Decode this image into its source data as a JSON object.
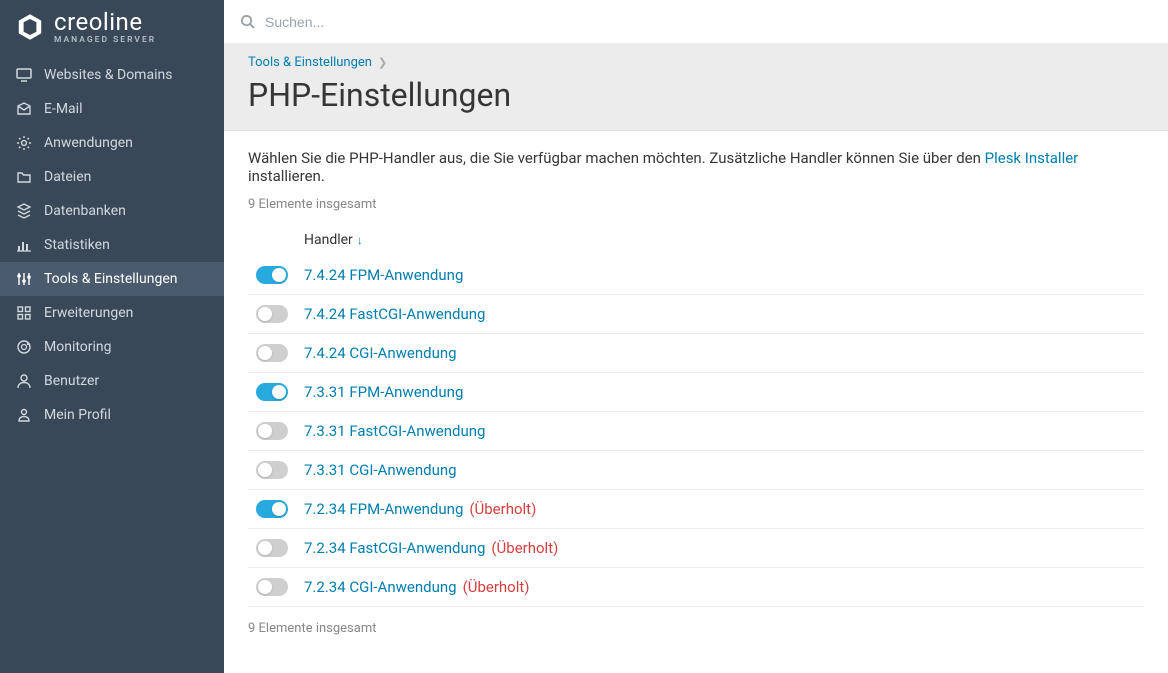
{
  "logo": {
    "main": "creoline",
    "sub": "MANAGED SERVER"
  },
  "search": {
    "placeholder": "Suchen..."
  },
  "sidebar": {
    "items": [
      {
        "label": "Websites & Domains",
        "icon": "monitor",
        "active": false
      },
      {
        "label": "E-Mail",
        "icon": "mail",
        "active": false
      },
      {
        "label": "Anwendungen",
        "icon": "gear",
        "active": false
      },
      {
        "label": "Dateien",
        "icon": "folder",
        "active": false
      },
      {
        "label": "Datenbanken",
        "icon": "layers",
        "active": false
      },
      {
        "label": "Statistiken",
        "icon": "stats",
        "active": false
      },
      {
        "label": "Tools & Einstellungen",
        "icon": "sliders",
        "active": true
      },
      {
        "label": "Erweiterungen",
        "icon": "grid",
        "active": false
      },
      {
        "label": "Monitoring",
        "icon": "radar",
        "active": false
      },
      {
        "label": "Benutzer",
        "icon": "user",
        "active": false
      },
      {
        "label": "Mein Profil",
        "icon": "profile",
        "active": false
      }
    ]
  },
  "breadcrumb": {
    "parent": "Tools & Einstellungen"
  },
  "page_title": "PHP-Einstellungen",
  "intro": {
    "prefix": "Wählen Sie die PHP-Handler aus, die Sie verfügbar machen möchten. Zusätzliche Handler können Sie über den ",
    "link": "Plesk Installer",
    "suffix": " installieren."
  },
  "count_text": "9 Elemente insgesamt",
  "columns": {
    "handler": "Handler"
  },
  "rows": [
    {
      "name": "7.4.24 FPM-Anwendung",
      "on": true,
      "deprecated": null
    },
    {
      "name": "7.4.24 FastCGI-Anwendung",
      "on": false,
      "deprecated": null
    },
    {
      "name": "7.4.24 CGI-Anwendung",
      "on": false,
      "deprecated": null
    },
    {
      "name": "7.3.31 FPM-Anwendung",
      "on": true,
      "deprecated": null
    },
    {
      "name": "7.3.31 FastCGI-Anwendung",
      "on": false,
      "deprecated": null
    },
    {
      "name": "7.3.31 CGI-Anwendung",
      "on": false,
      "deprecated": null
    },
    {
      "name": "7.2.34 FPM-Anwendung",
      "on": true,
      "deprecated": "(Überholt)"
    },
    {
      "name": "7.2.34 FastCGI-Anwendung",
      "on": false,
      "deprecated": "(Überholt)"
    },
    {
      "name": "7.2.34 CGI-Anwendung",
      "on": false,
      "deprecated": "(Überholt)"
    }
  ]
}
